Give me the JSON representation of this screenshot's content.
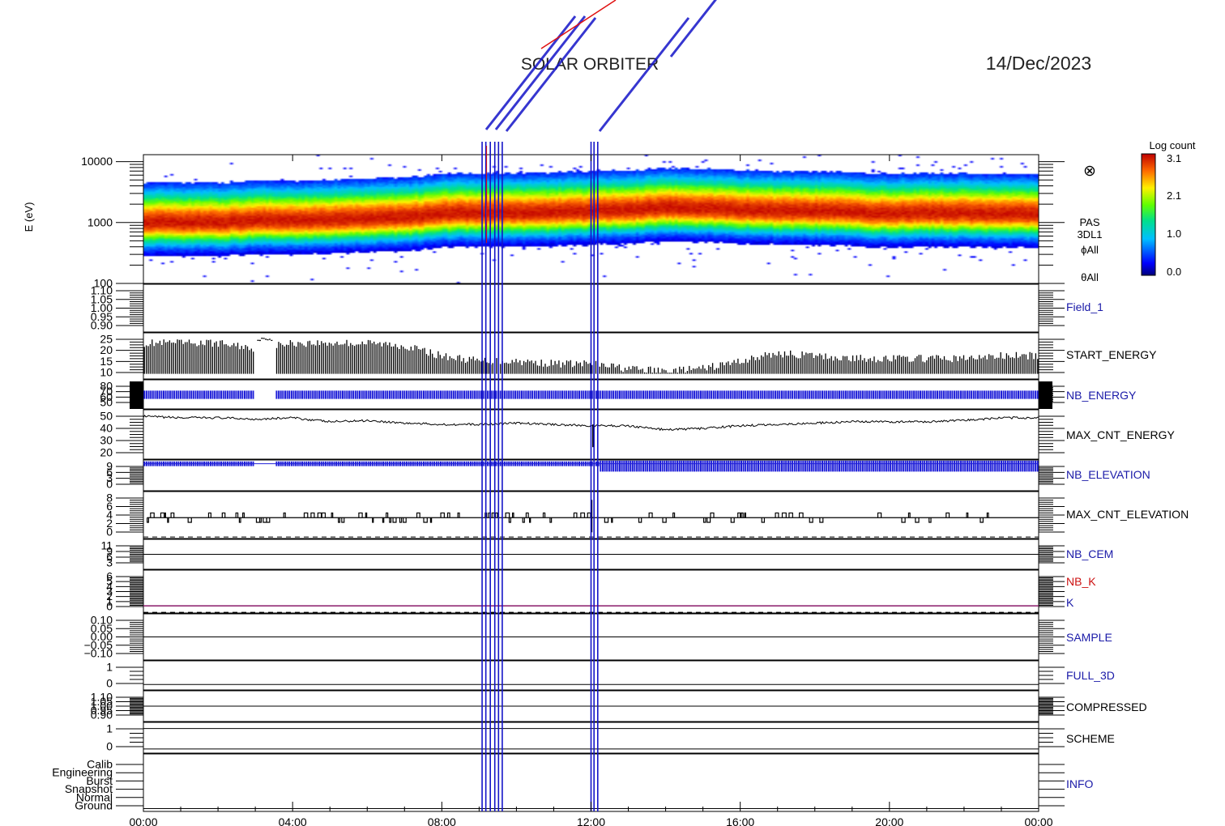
{
  "header": {
    "mission": "SOLAR ORBITER",
    "date": "14/Dec/2023"
  },
  "colorbar": {
    "title": "Log count",
    "ticks": [
      "3.1",
      "2.1",
      "1.0",
      "0.0"
    ],
    "range": [
      0.0,
      3.1
    ]
  },
  "spectrogram_labels": {
    "symbol": "⊗",
    "instrument": "PAS",
    "product": "3DL1",
    "phi": "ϕAll",
    "theta": "θAll"
  },
  "colors": {
    "blue_label": "#1a1aa8",
    "red_label": "#cc1111",
    "black_label": "#000000",
    "event_line": "#1414c8",
    "event_line_red": "#e01010"
  },
  "chart_data": {
    "type": "stacked-timeseries",
    "x_range_hours": [
      0,
      24
    ],
    "x_tick_labels": [
      "00:00",
      "04:00",
      "08:00",
      "12:00",
      "16:00",
      "20:00",
      "00:00"
    ],
    "event_lines_hours": [
      9.08,
      9.18,
      9.3,
      9.42,
      9.52,
      9.62,
      12.0,
      12.08,
      12.18
    ],
    "panels": [
      {
        "id": "energy",
        "label": "",
        "ylabel": "E (eV)",
        "yticks": [
          "10000",
          "1000",
          "100"
        ],
        "yscale": "log",
        "ylim": [
          100,
          13000
        ]
      },
      {
        "id": "field1",
        "label": "Field_1",
        "label_color": "blue",
        "yticks": [
          "1.10",
          "1.05",
          "1.00",
          "0.95",
          "0.90"
        ],
        "ylim": [
          0.9,
          1.1
        ]
      },
      {
        "id": "start_energy",
        "label": "START_ENERGY",
        "label_color": "black",
        "yticks": [
          "25",
          "20",
          "15",
          "10"
        ],
        "ylim": [
          7,
          25
        ]
      },
      {
        "id": "nb_energy",
        "label": "NB_ENERGY",
        "label_color": "blue",
        "yticks": [
          "80",
          "70",
          "60",
          "50"
        ],
        "ylim": [
          45,
          80
        ]
      },
      {
        "id": "max_cnt_energy",
        "label": "MAX_CNT_ENERGY",
        "label_color": "black",
        "yticks": [
          "50",
          "40",
          "30",
          "20"
        ],
        "ylim": [
          15,
          52
        ]
      },
      {
        "id": "nb_elevation",
        "label": "NB_ELEVATION",
        "label_color": "blue",
        "yticks": [
          "9",
          "6",
          "3",
          "0"
        ],
        "ylim": [
          0,
          9
        ]
      },
      {
        "id": "max_cnt_elevation",
        "label": "MAX_CNT_ELEVATION",
        "label_color": "black",
        "yticks": [
          "8",
          "6",
          "4",
          "2",
          "0"
        ],
        "ylim": [
          0,
          9
        ]
      },
      {
        "id": "nb_cem",
        "label": "NB_CEM",
        "label_color": "blue",
        "yticks": [
          "11",
          "9",
          "6",
          "3"
        ],
        "ylim": [
          0,
          11
        ]
      },
      {
        "id": "nb_k",
        "label": "NB_K",
        "label2": "K",
        "label_color": "red",
        "label2_color": "blue",
        "yticks": [
          "6",
          "5",
          "4",
          "3",
          "2",
          "1",
          "0"
        ],
        "ylim": [
          0,
          6
        ]
      },
      {
        "id": "sample",
        "label": "SAMPLE",
        "label_color": "blue",
        "yticks": [
          "0.10",
          "0.05",
          "0.00",
          "−0.05",
          "−0.10"
        ],
        "ylim": [
          -0.1,
          0.1
        ]
      },
      {
        "id": "full_3d",
        "label": "FULL_3D",
        "label_color": "blue",
        "yticks": [
          "1",
          "0"
        ],
        "ylim": [
          -0.3,
          1.3
        ]
      },
      {
        "id": "compressed",
        "label": "COMPRESSED",
        "label_color": "black",
        "yticks": [
          "1.10",
          "1.05",
          "1.00",
          "0.95",
          "0.90"
        ],
        "ylim": [
          0.9,
          1.1
        ]
      },
      {
        "id": "scheme",
        "label": "SCHEME",
        "label_color": "black",
        "yticks": [
          "1",
          "0"
        ],
        "ylim": [
          -0.2,
          1.3
        ]
      },
      {
        "id": "info",
        "label": "INFO",
        "label_color": "blue",
        "yticks": [
          "Calib",
          "Engineering",
          "Burst",
          "Snapshot",
          "Normal",
          "Ground"
        ],
        "ylim": [
          0,
          6
        ]
      }
    ],
    "series": {
      "start_energy_hourly": [
        21,
        21,
        21,
        19,
        21,
        21,
        21,
        20,
        16,
        14,
        14,
        13,
        13,
        11,
        10,
        11,
        14,
        17,
        16,
        15,
        15,
        15,
        15,
        16
      ],
      "max_cnt_energy_hourly": [
        47,
        46,
        46,
        45,
        46,
        43,
        44,
        42,
        41,
        41,
        42,
        41,
        40,
        40,
        37,
        38,
        40,
        41,
        42,
        43,
        43,
        43,
        44,
        46
      ],
      "max_cnt_elevation_level": 4,
      "nb_elevation_level": 8,
      "nb_k_level": 1,
      "nb_energy_level": 58,
      "spectrum_peak_log_energy_hourly": [
        3.0,
        3.0,
        3.0,
        3.02,
        3.03,
        3.04,
        3.06,
        3.08,
        3.14,
        3.15,
        3.15,
        3.16,
        3.18,
        3.2,
        3.24,
        3.22,
        3.2,
        3.18,
        3.18,
        3.16,
        3.14,
        3.15,
        3.15,
        3.14
      ],
      "spectrum_gap_hours": [
        2.95,
        3.55
      ]
    }
  }
}
